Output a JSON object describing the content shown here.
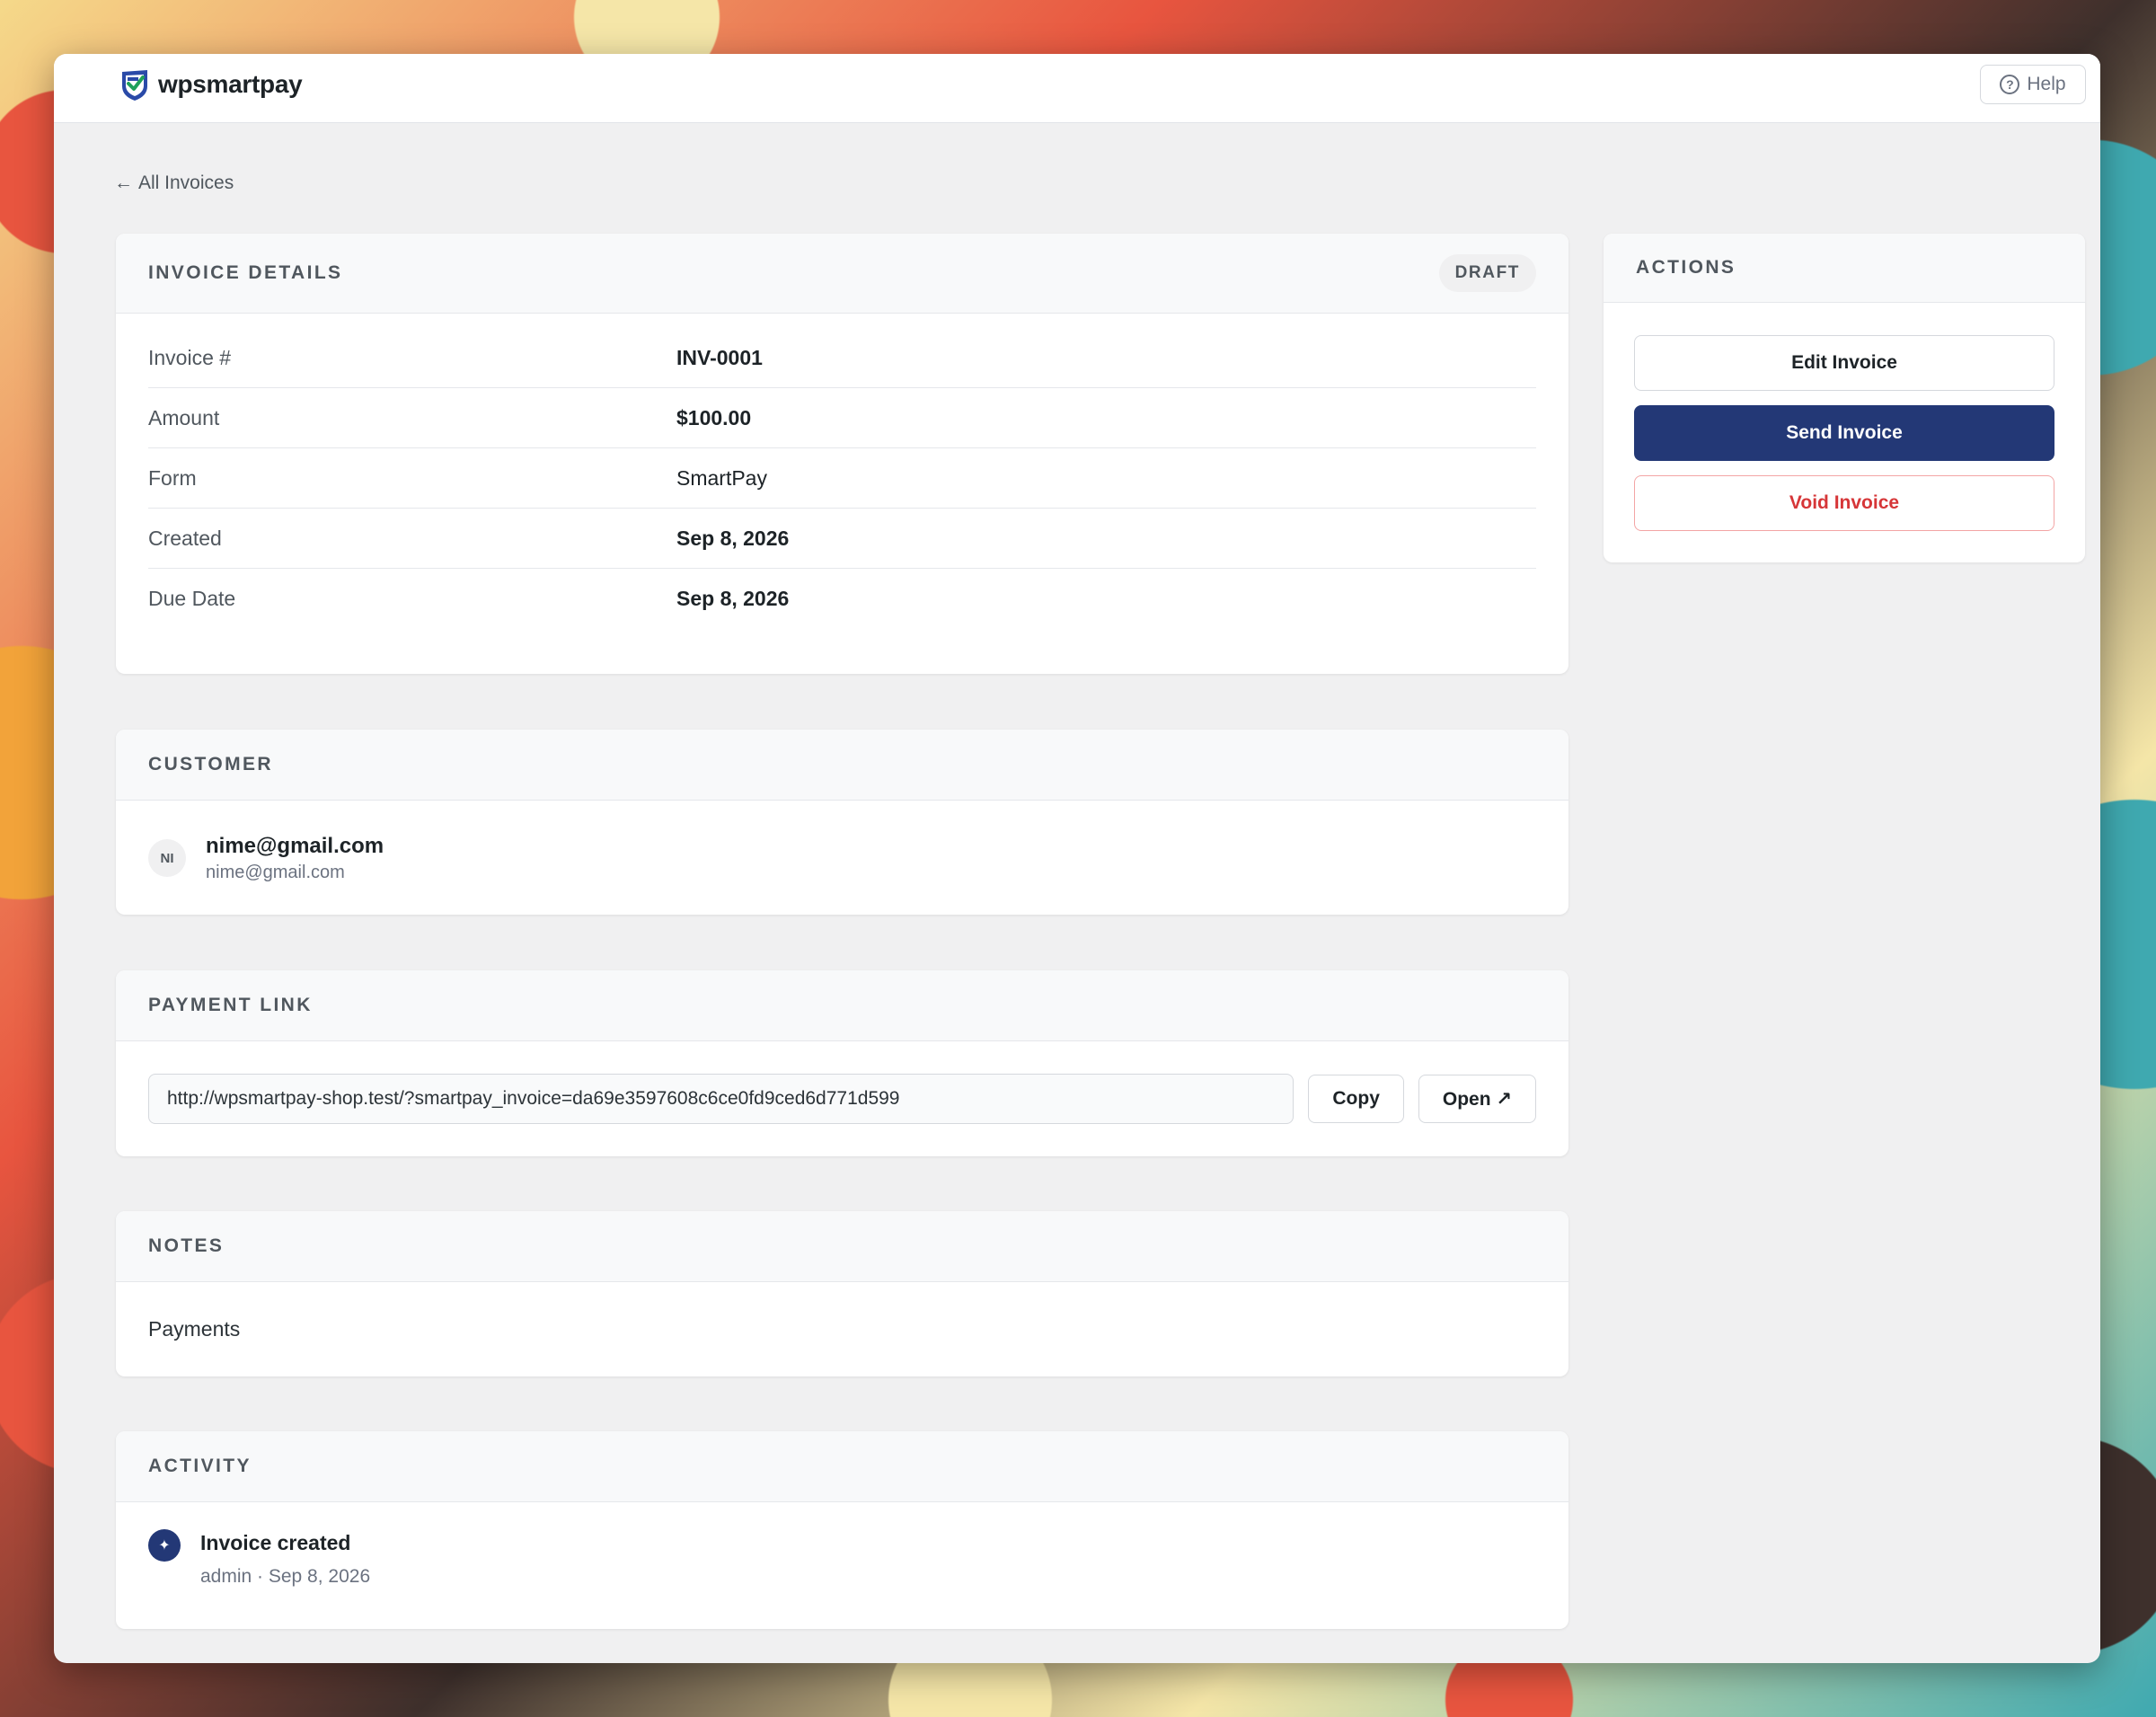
{
  "app": {
    "brand_name": "wpsmartpay",
    "help_label": "Help"
  },
  "nav": {
    "back_label": "All Invoices"
  },
  "invoice_details": {
    "title": "INVOICE DETAILS",
    "status_badge": "DRAFT",
    "rows": [
      {
        "label": "Invoice #",
        "value": "INV-0001"
      },
      {
        "label": "Amount",
        "value": "$100.00"
      },
      {
        "label": "Form",
        "value": "SmartPay"
      },
      {
        "label": "Created",
        "value": "Sep 8, 2026"
      },
      {
        "label": "Due Date",
        "value": "Sep 8, 2026"
      }
    ]
  },
  "customer": {
    "title": "CUSTOMER",
    "initials": "NI",
    "name": "nime@gmail.com",
    "email": "nime@gmail.com"
  },
  "payment_link": {
    "title": "PAYMENT LINK",
    "url": "http://wpsmartpay-shop.test/?smartpay_invoice=da69e3597608c6ce0fd9ced6d771d599",
    "copy_label": "Copy",
    "open_label": "Open ↗"
  },
  "notes": {
    "title": "NOTES",
    "text": "Payments"
  },
  "activity": {
    "title": "ACTIVITY",
    "items": [
      {
        "title": "Invoice created",
        "meta": "admin · Sep 8, 2026",
        "icon": "sparkle-icon"
      }
    ]
  },
  "actions": {
    "title": "ACTIONS",
    "edit_label": "Edit Invoice",
    "send_label": "Send Invoice",
    "void_label": "Void Invoice"
  },
  "colors": {
    "primary": "#233876",
    "danger": "#d63638",
    "page_bg": "#f0f0f1"
  }
}
